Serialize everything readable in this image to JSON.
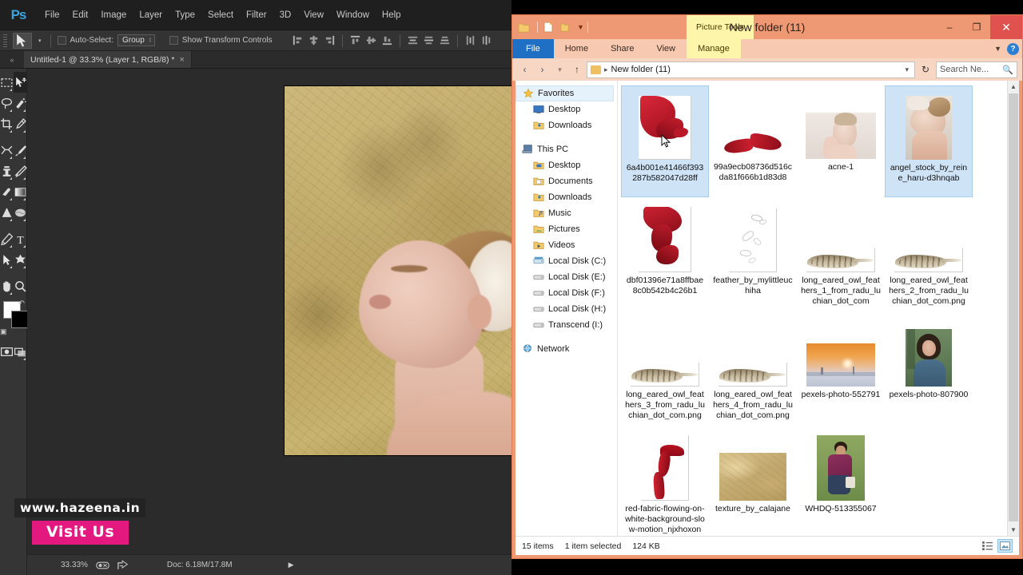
{
  "photoshop": {
    "app_name": "Ps",
    "menu": [
      "File",
      "Edit",
      "Image",
      "Layer",
      "Type",
      "Select",
      "Filter",
      "3D",
      "View",
      "Window",
      "Help"
    ],
    "options_bar": {
      "auto_select_label": "Auto-Select:",
      "group_value": "Group",
      "show_transform_label": "Show Transform Controls"
    },
    "document_tab": {
      "title": "Untitled-1 @ 33.3% (Layer 1, RGB/8) *",
      "close_label": "×"
    },
    "status_bar": {
      "zoom": "33.33%",
      "doc_label": "Doc: 6.18M/17.8M"
    },
    "tools": [
      "marquee-tool",
      "move-tool",
      "lasso-tool",
      "quick-selection-tool",
      "crop-tool",
      "eyedropper-tool",
      "healing-brush-tool",
      "brush-tool",
      "clone-stamp-tool",
      "history-brush-tool",
      "eraser-tool",
      "gradient-tool",
      "blur-tool",
      "dodge-tool",
      "pen-tool",
      "type-tool",
      "path-selection-tool",
      "shape-tool",
      "hand-tool",
      "zoom-tool"
    ],
    "colors": {
      "foreground": "#ffffff",
      "background": "#000000"
    }
  },
  "watermark": {
    "url": "www.hazeena.in",
    "button": "Visit Us",
    "accent": "#e4197f"
  },
  "explorer": {
    "title": "New folder (11)",
    "context_tab": "Picture Tools",
    "ribbon_tabs": [
      "File",
      "Home",
      "Share",
      "View",
      "Manage"
    ],
    "window_controls": {
      "minimize": "–",
      "maximize": "❐",
      "close": "✕"
    },
    "address": {
      "path": "New folder (11)",
      "separator": "▸"
    },
    "search": {
      "placeholder": "Search Ne..."
    },
    "nav": [
      {
        "label": "Favorites",
        "icon": "star-icon",
        "level": 0,
        "selected": true
      },
      {
        "label": "Desktop",
        "icon": "desktop-icon",
        "level": 1
      },
      {
        "label": "Downloads",
        "icon": "downloads-folder-icon",
        "level": 1
      },
      {
        "label": "This PC",
        "icon": "computer-icon",
        "level": 0
      },
      {
        "label": "Desktop",
        "icon": "desktop-folder-icon",
        "level": 1
      },
      {
        "label": "Documents",
        "icon": "documents-folder-icon",
        "level": 1
      },
      {
        "label": "Downloads",
        "icon": "downloads-folder-icon",
        "level": 1
      },
      {
        "label": "Music",
        "icon": "music-folder-icon",
        "level": 1
      },
      {
        "label": "Pictures",
        "icon": "pictures-folder-icon",
        "level": 1
      },
      {
        "label": "Videos",
        "icon": "videos-folder-icon",
        "level": 1
      },
      {
        "label": "Local Disk (C:)",
        "icon": "system-drive-icon",
        "level": 1
      },
      {
        "label": "Local Disk (E:)",
        "icon": "drive-icon",
        "level": 1
      },
      {
        "label": "Local Disk (F:)",
        "icon": "drive-icon",
        "level": 1
      },
      {
        "label": "Local Disk (H:)",
        "icon": "drive-icon",
        "level": 1
      },
      {
        "label": "Transcend (I:)",
        "icon": "drive-icon",
        "level": 1
      },
      {
        "label": "Network",
        "icon": "network-icon",
        "level": 0
      }
    ],
    "files": [
      {
        "name": "6a4b001e41466f393287b582047d28ff",
        "art": "red-cloth-1",
        "selected": true
      },
      {
        "name": "99a9ecb08736d516cda81f666b1d83d8",
        "art": "red-wing"
      },
      {
        "name": "acne-1",
        "art": "photo-woman-face"
      },
      {
        "name": "angel_stock_by_reine_haru-d3hnqab",
        "art": "photo-angel",
        "selected": true
      },
      {
        "name": "dbf01396e71a8ffbae8c0b542b4c26b1",
        "art": "red-cloth-2"
      },
      {
        "name": "feather_by_mylittleuchiha",
        "art": "feather-sketch"
      },
      {
        "name": "long_eared_owl_feathers_1_from_radu_luchian_dot_com",
        "art": "owl-feather"
      },
      {
        "name": "long_eared_owl_feathers_2_from_radu_luchian_dot_com.png",
        "art": "owl-feather"
      },
      {
        "name": "long_eared_owl_feathers_3_from_radu_luchian_dot_com.png",
        "art": "owl-feather"
      },
      {
        "name": "long_eared_owl_feathers_4_from_radu_luchian_dot_com.png",
        "art": "owl-feather"
      },
      {
        "name": "pexels-photo-552791",
        "art": "photo-sunset"
      },
      {
        "name": "pexels-photo-807900",
        "art": "photo-portrait-green"
      },
      {
        "name": "red-fabric-flowing-on-white-background-slow-motion_njxhoxong...",
        "art": "red-fabric-pipe"
      },
      {
        "name": "texture_by_calajane",
        "art": "gold-texture"
      },
      {
        "name": "WHDQ-513355067",
        "art": "photo-man"
      }
    ],
    "status": {
      "items_count": "15 items",
      "selection": "1 item selected",
      "size": "124 KB"
    },
    "theme": {
      "title_bar": "#ef9974",
      "file_tab": "#1f6fc4",
      "context_tab": "#fdf5a9",
      "selection": "#cfe3f7"
    }
  }
}
